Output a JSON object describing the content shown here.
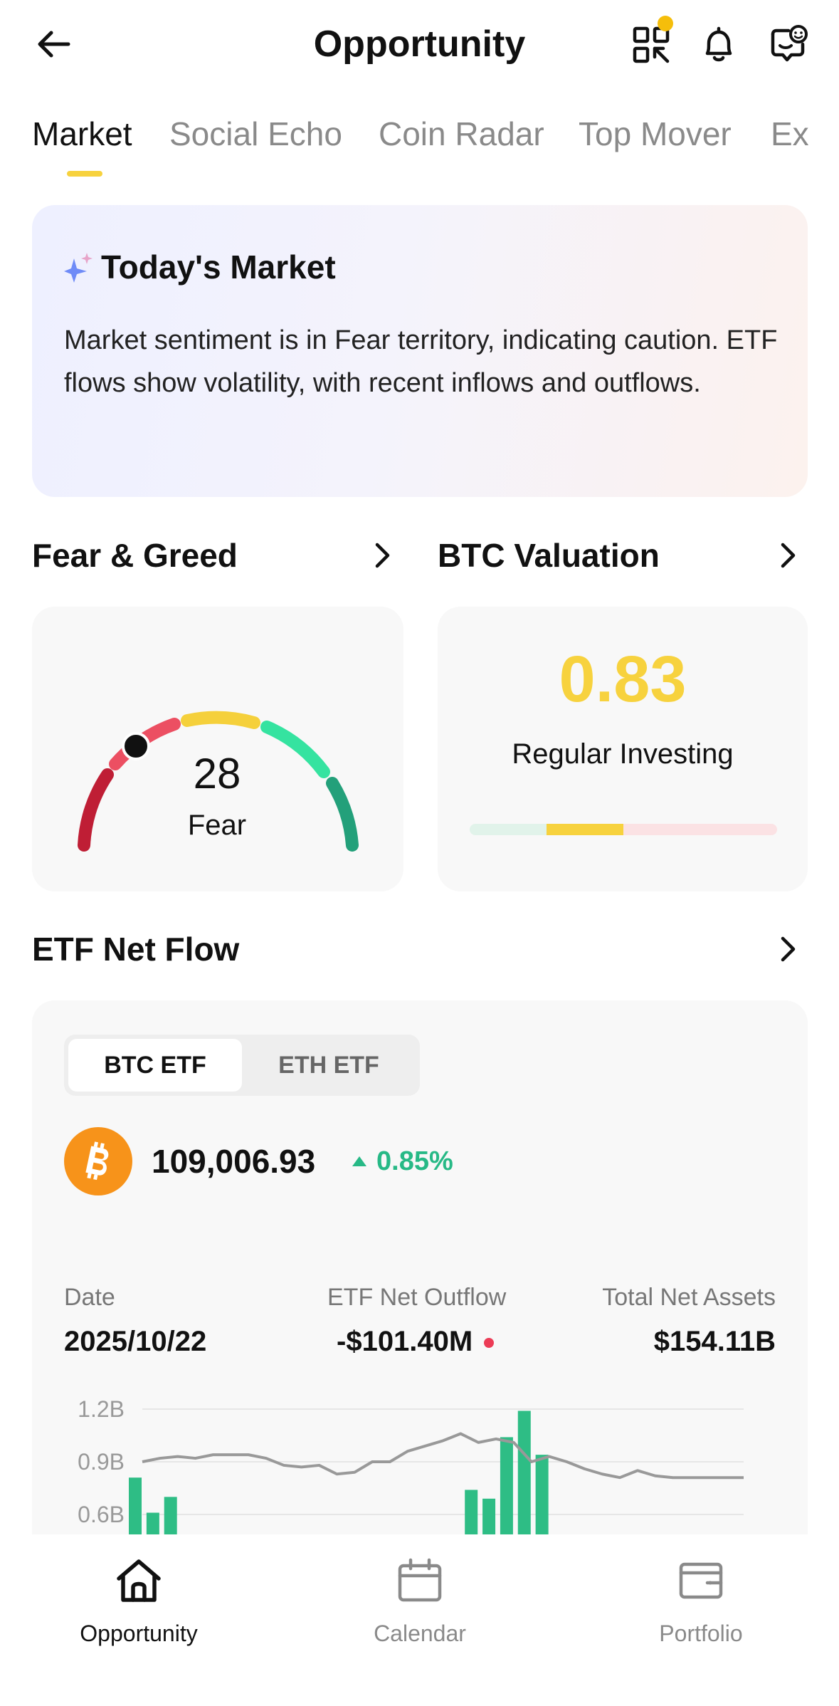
{
  "header": {
    "title": "Opportunity"
  },
  "tabs": [
    {
      "label": "Market",
      "active": true
    },
    {
      "label": "Social Echo",
      "active": false
    },
    {
      "label": "Coin Radar",
      "active": false
    },
    {
      "label": "Top Mover",
      "active": false
    },
    {
      "label": "Exp",
      "active": false
    }
  ],
  "todays_market": {
    "title": "Today's Market",
    "text": "Market sentiment is in Fear territory, indicating caution. ETF flows show volatility, with recent inflows and outflows."
  },
  "fear_greed": {
    "title": "Fear & Greed",
    "value": "28",
    "label": "Fear"
  },
  "btc_valuation": {
    "title": "BTC Valuation",
    "value": "0.83",
    "label": "Regular Investing"
  },
  "etf": {
    "title": "ETF Net Flow",
    "tabs": [
      {
        "label": "BTC ETF",
        "active": true
      },
      {
        "label": "ETH ETF",
        "active": false
      }
    ],
    "price": "109,006.93",
    "change": "0.85%",
    "date_label": "Date",
    "date_value": "2025/10/22",
    "flow_label": "ETF Net Outflow",
    "flow_value": "-$101.40M",
    "assets_label": "Total Net Assets",
    "assets_value": "$154.11B"
  },
  "chart_data": {
    "type": "bar",
    "title": "",
    "xlabel": "",
    "ylabel": "",
    "y_ticks": [
      "1.2B",
      "0.9B",
      "0.6B"
    ],
    "ylim": [
      0.6,
      1.2
    ],
    "series": [
      {
        "type": "bar",
        "color": "#2EBD85",
        "values": [
          0.81,
          0.61,
          0.7,
          0,
          0,
          0,
          0,
          0,
          0,
          0,
          0,
          0,
          0,
          0,
          0,
          0,
          0,
          0,
          0,
          0.74,
          0.69,
          1.04,
          1.19,
          0.94,
          0,
          0,
          0,
          0,
          0,
          0,
          0,
          0,
          0,
          0,
          0
        ]
      },
      {
        "type": "line",
        "color": "#999999",
        "values": [
          0.9,
          0.92,
          0.93,
          0.92,
          0.94,
          0.94,
          0.94,
          0.92,
          0.88,
          0.87,
          0.88,
          0.83,
          0.84,
          0.9,
          0.9,
          0.96,
          0.99,
          1.02,
          1.06,
          1.01,
          1.03,
          1.01,
          0.9,
          0.93,
          0.9,
          0.86,
          0.83,
          0.81,
          0.85,
          0.82,
          0.81,
          0.81,
          0.81,
          0.81,
          0.81
        ]
      }
    ]
  },
  "bottom_nav": [
    {
      "label": "Opportunity",
      "active": true
    },
    {
      "label": "Calendar",
      "active": false
    },
    {
      "label": "Portfolio",
      "active": false
    }
  ],
  "colors": {
    "accent_yellow": "#F7D23E",
    "positive": "#27B986",
    "negative": "#EC3C56",
    "bitcoin": "#F7931A"
  }
}
